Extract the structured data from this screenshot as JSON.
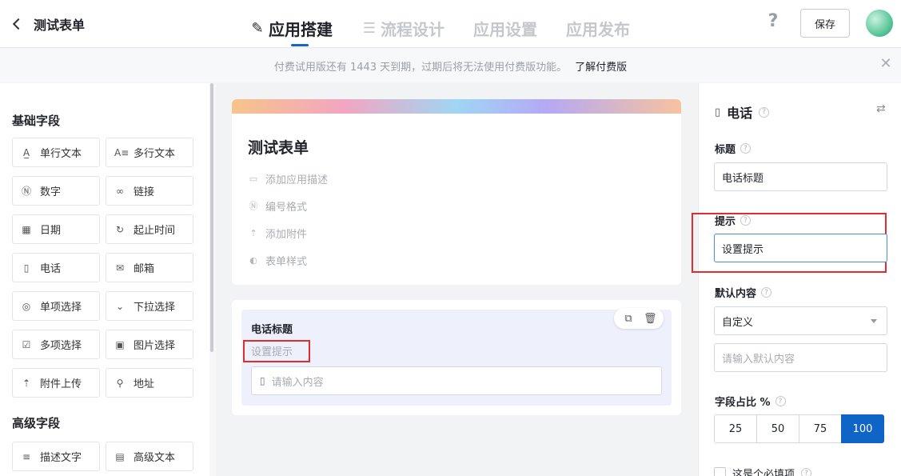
{
  "header": {
    "back_title": "测试表单",
    "tabs": [
      {
        "label": "应用搭建",
        "icon": "edit-icon",
        "active": true
      },
      {
        "label": "流程设计",
        "icon": "flow-icon",
        "active": false
      },
      {
        "label": "应用设置",
        "active": false
      },
      {
        "label": "应用发布",
        "active": false
      }
    ],
    "help_label": "?",
    "save_label": "保存"
  },
  "notice": {
    "text": "付费试用版还有 1443 天到期，过期后将无法使用付费版功能。",
    "link": "了解付费版"
  },
  "palette": {
    "basic_title": "基础字段",
    "basic_fields": [
      {
        "label": "单行文本",
        "icon": "single-line-text-icon"
      },
      {
        "label": "多行文本",
        "icon": "multi-line-text-icon"
      },
      {
        "label": "数字",
        "icon": "number-icon"
      },
      {
        "label": "链接",
        "icon": "link-icon"
      },
      {
        "label": "日期",
        "icon": "calendar-icon"
      },
      {
        "label": "起止时间",
        "icon": "time-range-icon"
      },
      {
        "label": "电话",
        "icon": "phone-icon"
      },
      {
        "label": "邮箱",
        "icon": "mail-icon"
      },
      {
        "label": "单项选择",
        "icon": "radio-icon"
      },
      {
        "label": "下拉选择",
        "icon": "dropdown-icon"
      },
      {
        "label": "多项选择",
        "icon": "checkbox-icon"
      },
      {
        "label": "图片选择",
        "icon": "image-icon"
      },
      {
        "label": "附件上传",
        "icon": "upload-icon"
      },
      {
        "label": "地址",
        "icon": "address-icon"
      }
    ],
    "advanced_title": "高级字段",
    "advanced_fields": [
      {
        "label": "描述文字",
        "icon": "description-icon"
      },
      {
        "label": "高级文本",
        "icon": "rich-text-icon"
      }
    ]
  },
  "form": {
    "title": "测试表单",
    "options": [
      {
        "label": "添加应用描述",
        "icon": "comment-icon"
      },
      {
        "label": "编号格式",
        "icon": "number-format-icon"
      },
      {
        "label": "添加附件",
        "icon": "upload-icon"
      },
      {
        "label": "表单样式",
        "icon": "palette-icon"
      }
    ],
    "field": {
      "label": "电话标题",
      "hint": "设置提示",
      "input_placeholder": "请输入内容"
    }
  },
  "props": {
    "type_label": "电话",
    "title_label": "标题",
    "title_value": "电话标题",
    "hint_label": "提示",
    "hint_value": "设置提示",
    "default_label": "默认内容",
    "default_select": "自定义",
    "default_placeholder": "请输入默认内容",
    "ratio_label": "字段占比 %",
    "ratio_options": [
      "25",
      "50",
      "75",
      "100"
    ],
    "ratio_selected": "100",
    "required_label": "这是个必填项"
  },
  "colors": {
    "accent": "#1064c6",
    "highlight": "#e02e2e"
  }
}
